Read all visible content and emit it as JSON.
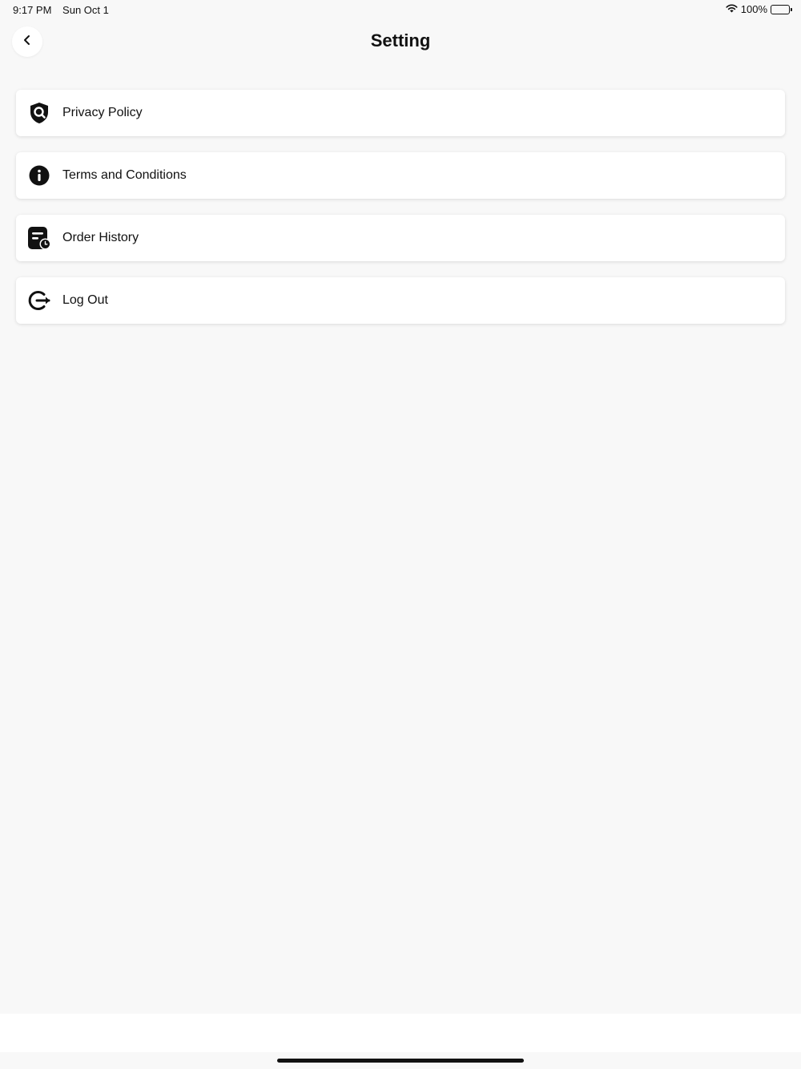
{
  "status_bar": {
    "time": "9:17 PM",
    "date": "Sun Oct 1",
    "battery": "100%"
  },
  "header": {
    "title": "Setting",
    "back_icon": "chevron-left-icon"
  },
  "menu": [
    {
      "label": "Privacy Policy",
      "icon": "shield-search-icon"
    },
    {
      "label": "Terms and Conditions",
      "icon": "info-icon"
    },
    {
      "label": "Order History",
      "icon": "order-history-icon"
    },
    {
      "label": "Log Out",
      "icon": "logout-icon"
    }
  ]
}
